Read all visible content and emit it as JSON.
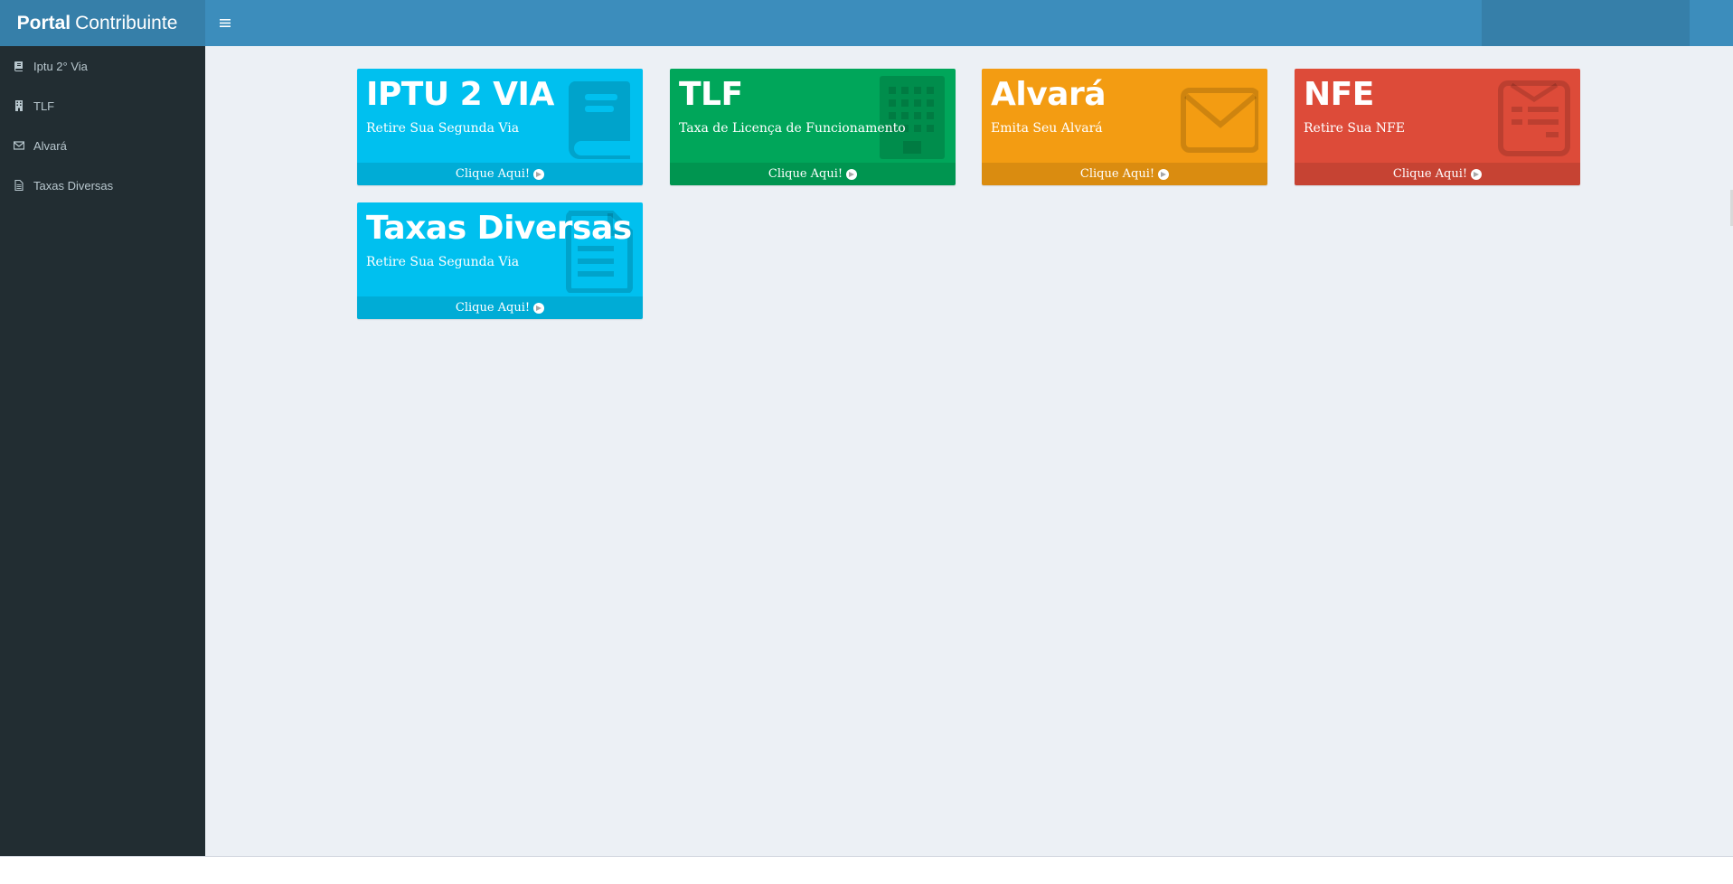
{
  "app": {
    "logo_bold": "Portal",
    "logo_light": "Contribuinte"
  },
  "sidebar": {
    "items": [
      {
        "label": "Iptu 2° Via",
        "icon": "book-icon"
      },
      {
        "label": "TLF",
        "icon": "building-icon"
      },
      {
        "label": "Alvará",
        "icon": "envelope-icon"
      },
      {
        "label": "Taxas Diversas",
        "icon": "file-text-icon"
      }
    ]
  },
  "colors": {
    "aqua": "#00c0ef",
    "green": "#00a65a",
    "yellow": "#f39c12",
    "red": "#dd4b39",
    "sidebar": "#222d32",
    "header": "#3c8dbc"
  },
  "boxes": [
    {
      "title": "IPTU 2 VIA",
      "subtitle": "Retire Sua Segunda Via",
      "link": "Clique Aqui!",
      "icon": "book-icon",
      "color": "#00c0ef"
    },
    {
      "title": "TLF",
      "subtitle": "Taxa de Licença de Funcionamento",
      "link": "Clique Aqui!",
      "icon": "building-icon",
      "color": "#00a65a"
    },
    {
      "title": "Alvará",
      "subtitle": "Emita Seu Alvará",
      "link": "Clique Aqui!",
      "icon": "envelope-icon",
      "color": "#f39c12"
    },
    {
      "title": "NFE",
      "subtitle": "Retire Sua NFE",
      "link": "Clique Aqui!",
      "icon": "newspaper-icon",
      "color": "#dd4b39"
    },
    {
      "title": "Taxas Diversas",
      "subtitle": "Retire Sua Segunda Via",
      "link": "Clique Aqui!",
      "icon": "file-text-icon",
      "color": "#00c0ef"
    }
  ]
}
